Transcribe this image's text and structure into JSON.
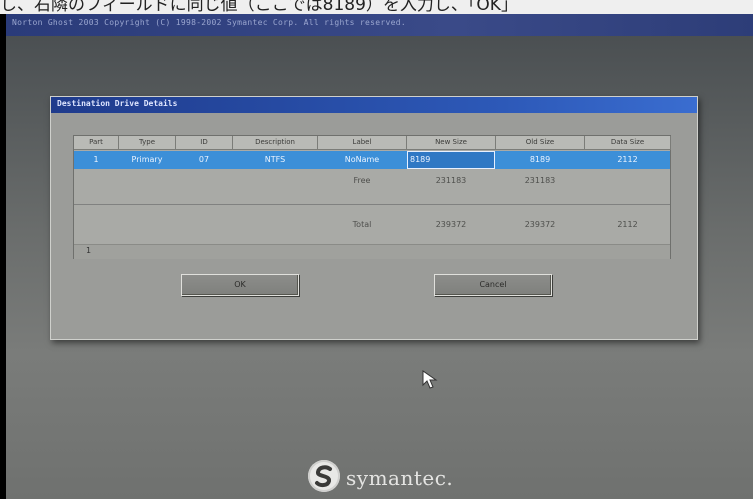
{
  "top_strip": {
    "text": "し、右隣のフィールドに同じ値（ここでは8189）を入力し、「OK」"
  },
  "window": {
    "title": "Norton Ghost 2003   Copyright (C) 1998-2002 Symantec Corp. All rights reserved."
  },
  "dialog": {
    "title": "Destination Drive Details",
    "columns": [
      "Part",
      "Type",
      "ID",
      "Description",
      "Label",
      "New Size",
      "Old Size",
      "Data Size"
    ],
    "rows": [
      {
        "part": "1",
        "type": "Primary",
        "id": "07",
        "description": "NTFS",
        "label": "NoName",
        "new_size": "8189",
        "old_size": "8189",
        "data_size": "2112"
      },
      {
        "part": "",
        "type": "",
        "id": "",
        "description": "",
        "label": "Free",
        "new_size": "231183",
        "old_size": "231183",
        "data_size": ""
      },
      {
        "part": "",
        "type": "",
        "id": "",
        "description": "",
        "label": "Total",
        "new_size": "239372",
        "old_size": "239372",
        "data_size": "2112"
      }
    ],
    "status_value": "1",
    "ok_label": "OK",
    "cancel_label": "Cancel"
  },
  "brand": {
    "logo_text": "symantec."
  },
  "colors": {
    "selection": "#3c8fd8",
    "dialog_title": "#1f3b8c",
    "screen_bg": "#6a6d6c"
  }
}
